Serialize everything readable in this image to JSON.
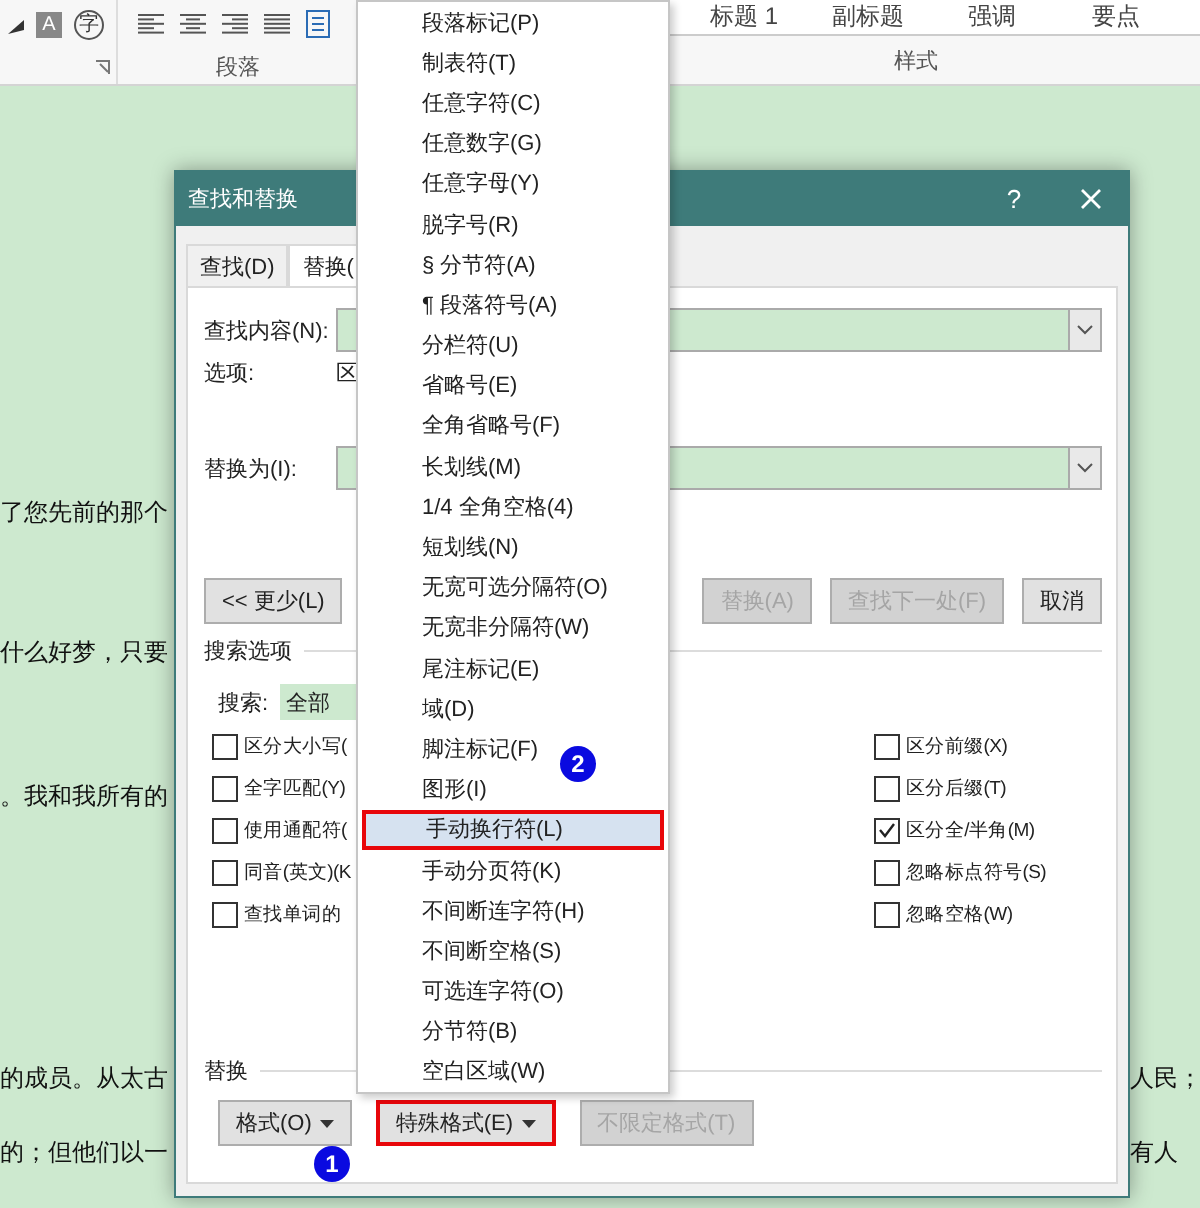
{
  "ribbon": {
    "glyph_buttons": [
      "A",
      "字"
    ],
    "paragraph_group": "段落",
    "styles_group": "样式",
    "styles": [
      "标题 1",
      "副标题",
      "强调",
      "要点"
    ]
  },
  "document": {
    "left_lines": [
      "了您先前的那个",
      "什么好梦，只要",
      "。我和我所有的",
      "的成员。从太古",
      "的；但他们以一"
    ],
    "right_lines": [
      "人民；",
      "有人"
    ]
  },
  "dialog": {
    "title": "查找和替换",
    "help": "?",
    "tabs": [
      {
        "label": "查找(D)",
        "selected": false
      },
      {
        "label": "替换(",
        "selected": true
      }
    ],
    "find_label": "查找内容(N):",
    "options_label": "选项:",
    "options_value": "区",
    "replace_label": "替换为(I):",
    "buttons": [
      {
        "label": "<< 更少(L)",
        "disabled": false
      },
      {
        "label": "替换(A)",
        "disabled": true
      },
      {
        "label": "查找下一处(F)",
        "disabled": true
      },
      {
        "label": "取消",
        "disabled": false
      }
    ],
    "search_options_label": "搜索选项",
    "search_label": "搜索:",
    "search_value": "全部",
    "left_checks": [
      {
        "label": "区分大小写(",
        "checked": false
      },
      {
        "label": "全字匹配(Y)",
        "checked": false
      },
      {
        "label": "使用通配符(",
        "checked": false
      },
      {
        "label": "同音(英文)(K",
        "checked": false
      },
      {
        "label": "查找单词的",
        "checked": false
      }
    ],
    "right_checks": [
      {
        "label": "区分前缀(X)",
        "checked": false
      },
      {
        "label": "区分后缀(T)",
        "checked": false
      },
      {
        "label": "区分全/半角(M)",
        "checked": true
      },
      {
        "label": "忽略标点符号(S)",
        "checked": false
      },
      {
        "label": "忽略空格(W)",
        "checked": false
      }
    ],
    "replace_section_label": "替换",
    "bottom_buttons": [
      {
        "label": "格式(O)",
        "disabled": false,
        "highlighted": false
      },
      {
        "label": "特殊格式(E)",
        "disabled": false,
        "highlighted": true
      },
      {
        "label": "不限定格式(T)",
        "disabled": true,
        "highlighted": false
      }
    ]
  },
  "menu": {
    "items": [
      {
        "label": "段落标记(P)",
        "selected": false
      },
      {
        "label": "制表符(T)",
        "selected": false
      },
      {
        "label": "任意字符(C)",
        "selected": false
      },
      {
        "label": "任意数字(G)",
        "selected": false
      },
      {
        "label": "任意字母(Y)",
        "selected": false
      },
      {
        "label": "脱字号(R)",
        "selected": false
      },
      {
        "label": "§ 分节符(A)",
        "selected": false
      },
      {
        "label": "¶ 段落符号(A)",
        "selected": false
      },
      {
        "label": "分栏符(U)",
        "selected": false
      },
      {
        "label": "省略号(E)",
        "selected": false
      },
      {
        "label": "全角省略号(F)",
        "selected": false
      },
      {
        "label": "长划线(M)",
        "selected": false
      },
      {
        "label": "1/4 全角空格(4)",
        "selected": false
      },
      {
        "label": "短划线(N)",
        "selected": false
      },
      {
        "label": "无宽可选分隔符(O)",
        "selected": false
      },
      {
        "label": "无宽非分隔符(W)",
        "selected": false
      },
      {
        "label": "尾注标记(E)",
        "selected": false
      },
      {
        "label": "域(D)",
        "selected": false
      },
      {
        "label": "脚注标记(F)",
        "selected": false
      },
      {
        "label": "图形(I)",
        "selected": false
      },
      {
        "label": "手动换行符(L)",
        "selected": true
      },
      {
        "label": "手动分页符(K)",
        "selected": false
      },
      {
        "label": "不间断连字符(H)",
        "selected": false
      },
      {
        "label": "不间断空格(S)",
        "selected": false
      },
      {
        "label": "可选连字符(O)",
        "selected": false
      },
      {
        "label": "分节符(B)",
        "selected": false
      },
      {
        "label": "空白区域(W)",
        "selected": false
      }
    ]
  },
  "step_badges": [
    "1",
    "2"
  ]
}
